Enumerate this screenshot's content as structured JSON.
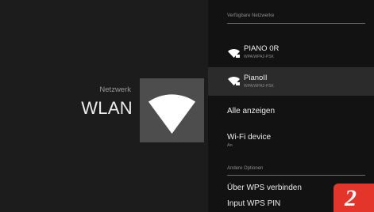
{
  "header": {
    "breadcrumb": "Netzwerk",
    "title": "WLAN"
  },
  "hero_icon": "wifi-icon",
  "available_section": {
    "label": "Verfügbare Netzwerke"
  },
  "networks": [
    {
      "name": "PIANO 0R",
      "security": "WPA/WPA2-PSK",
      "icon": "wifi-lock-icon",
      "selected": false
    },
    {
      "name": "PianoII",
      "security": "WPA/WPA2-PSK",
      "icon": "wifi-lock-icon",
      "selected": true
    }
  ],
  "show_all": {
    "label": "Alle anzeigen"
  },
  "wifi_device": {
    "label": "Wi-Fi device",
    "status": "An"
  },
  "other_section": {
    "label": "Andere Optionen"
  },
  "wps_connect": {
    "label": "Über WPS verbinden"
  },
  "wps_pin": {
    "label": "Input WPS PIN"
  },
  "page_badge": {
    "text": "2",
    "color": "#e4352a"
  },
  "colors": {
    "background": "#161616",
    "panel": "#121212",
    "tile": "#4d4d4d",
    "selected_row": "#2b2b2b"
  }
}
